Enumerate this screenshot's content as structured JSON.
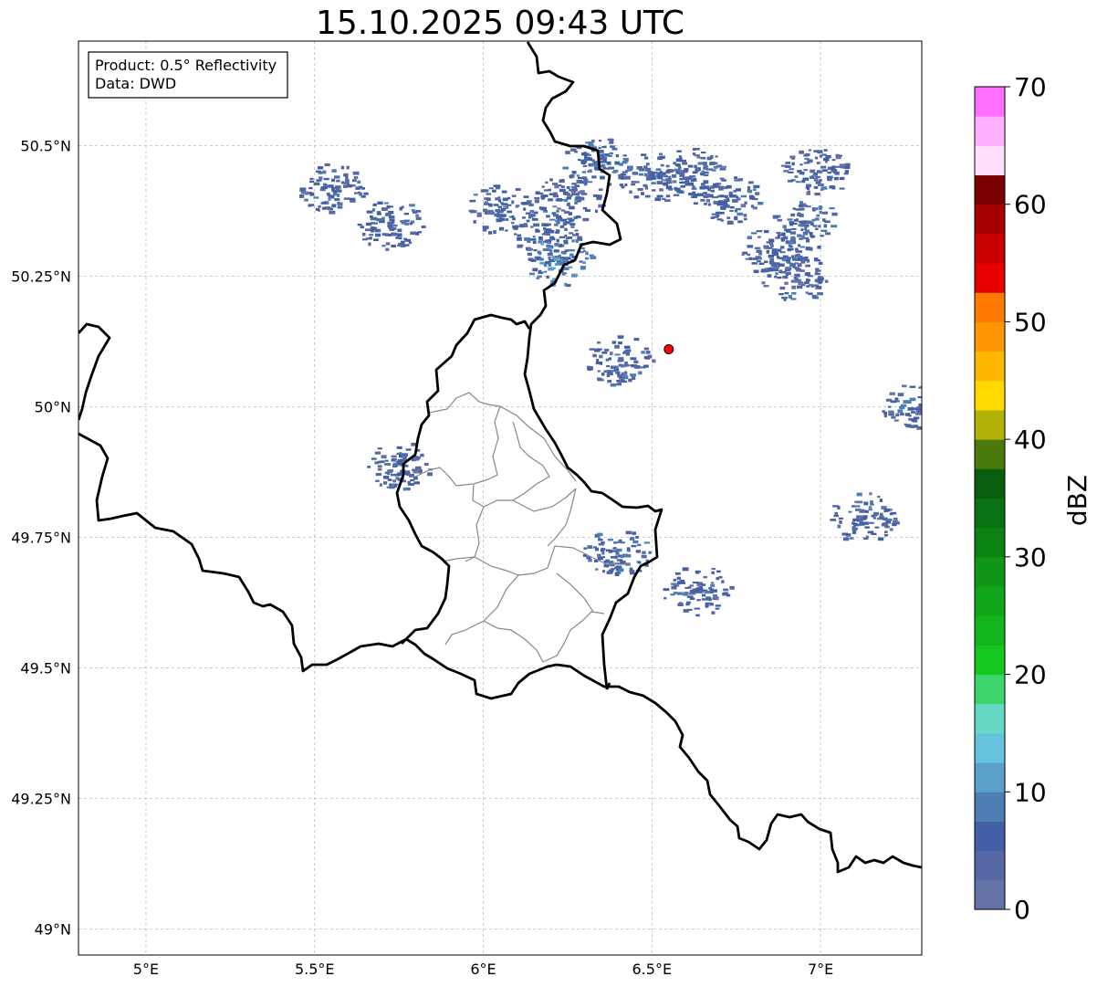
{
  "title": "15.10.2025 09:43 UTC",
  "info_box": {
    "product": "Product: 0.5° Reflectivity",
    "data_source": "Data: DWD"
  },
  "map": {
    "lon_range": [
      4.8,
      7.3
    ],
    "lat_range": [
      48.95,
      50.7
    ],
    "lon_ticks": [
      {
        "value": 5.0,
        "label": "5°E"
      },
      {
        "value": 5.5,
        "label": "5.5°E"
      },
      {
        "value": 6.0,
        "label": "6°E"
      },
      {
        "value": 6.5,
        "label": "6.5°E"
      },
      {
        "value": 7.0,
        "label": "7°E"
      }
    ],
    "lat_ticks": [
      {
        "value": 50.5,
        "label": "50.5°N"
      },
      {
        "value": 50.25,
        "label": "50.25°N"
      },
      {
        "value": 50.0,
        "label": "50°N"
      },
      {
        "value": 49.75,
        "label": "49.75°N"
      },
      {
        "value": 49.5,
        "label": "49.5°N"
      },
      {
        "value": 49.25,
        "label": "49.25°N"
      },
      {
        "value": 49.0,
        "label": "49°N"
      }
    ],
    "grid": true,
    "radar_site": {
      "lon": 6.55,
      "lat": 50.11,
      "color": "#ff0000"
    }
  },
  "colorbar": {
    "label": "dBZ",
    "min": 0,
    "max": 70,
    "step": 2.5,
    "ticks": [
      "0",
      "10",
      "20",
      "30",
      "40",
      "50",
      "60",
      "70"
    ],
    "colors": [
      "#6473a8",
      "#5568a3",
      "#435fa6",
      "#4d7db3",
      "#5aa0c8",
      "#66c3dd",
      "#66d9c4",
      "#3ed46e",
      "#14c81e",
      "#12b51b",
      "#11a51a",
      "#0f9517",
      "#0c8414",
      "#097212",
      "#075e0e",
      "#4a7a0a",
      "#b0b206",
      "#ffd900",
      "#ffb700",
      "#ff9800",
      "#ff7a00",
      "#e60000",
      "#c80000",
      "#a80000",
      "#7a0000",
      "#ffe0ff",
      "#ffb1ff",
      "#ff6eff",
      "#ee33ee"
    ]
  },
  "echo_cells": [
    {
      "lon": 6.25,
      "lat": 50.4,
      "dbz": 5
    },
    {
      "lon": 6.18,
      "lat": 50.33,
      "dbz": 5
    },
    {
      "lon": 6.22,
      "lat": 50.28,
      "dbz": 8
    },
    {
      "lon": 6.05,
      "lat": 50.38,
      "dbz": 5
    },
    {
      "lon": 6.33,
      "lat": 50.47,
      "dbz": 6
    },
    {
      "lon": 6.5,
      "lat": 50.44,
      "dbz": 5
    },
    {
      "lon": 6.62,
      "lat": 50.45,
      "dbz": 5
    },
    {
      "lon": 6.72,
      "lat": 50.4,
      "dbz": 5
    },
    {
      "lon": 6.86,
      "lat": 50.3,
      "dbz": 5
    },
    {
      "lon": 6.95,
      "lat": 50.35,
      "dbz": 6
    },
    {
      "lon": 6.98,
      "lat": 50.45,
      "dbz": 5
    },
    {
      "lon": 6.92,
      "lat": 50.25,
      "dbz": 5
    },
    {
      "lon": 6.4,
      "lat": 50.09,
      "dbz": 5
    },
    {
      "lon": 7.12,
      "lat": 49.79,
      "dbz": 5
    },
    {
      "lon": 6.39,
      "lat": 49.72,
      "dbz": 6
    },
    {
      "lon": 5.74,
      "lat": 49.89,
      "dbz": 5
    },
    {
      "lon": 5.72,
      "lat": 50.35,
      "dbz": 5
    },
    {
      "lon": 5.55,
      "lat": 50.42,
      "dbz": 5
    },
    {
      "lon": 6.63,
      "lat": 49.65,
      "dbz": 5
    },
    {
      "lon": 7.28,
      "lat": 50.0,
      "dbz": 5
    }
  ]
}
